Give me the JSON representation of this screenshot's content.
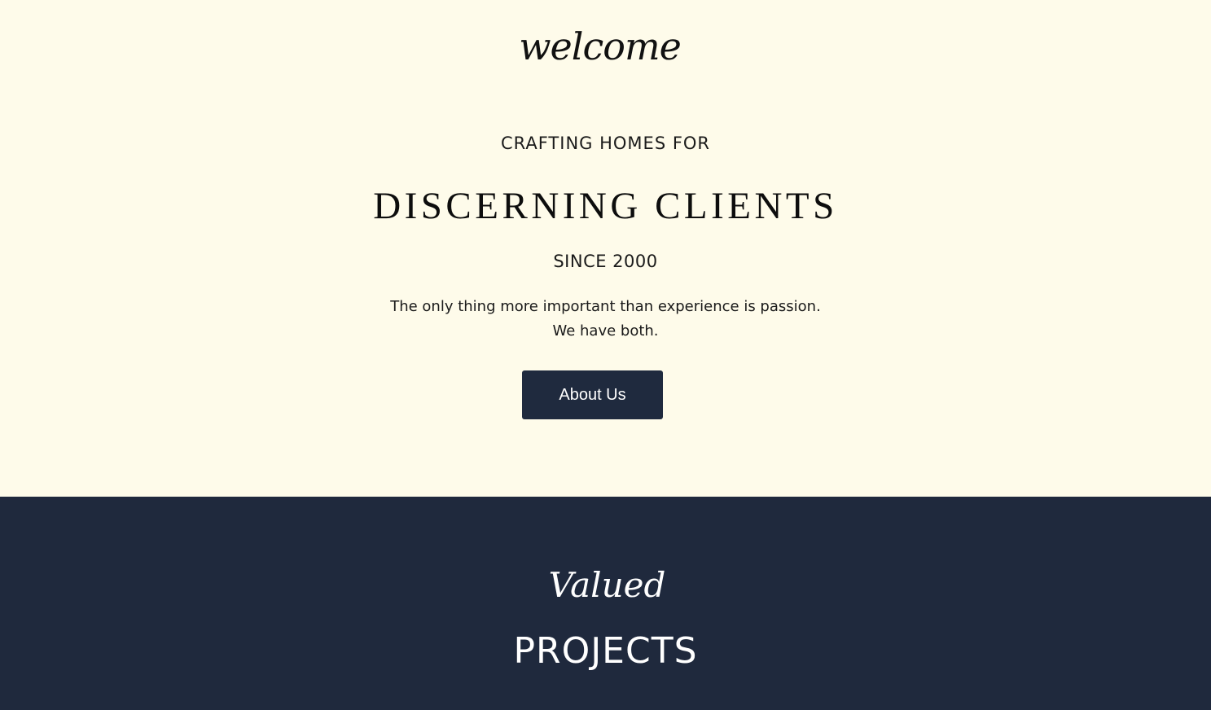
{
  "hero": {
    "script_heading": "welcome",
    "eyebrow": "CRAFTING HOMES FOR",
    "title": "DISCERNING CLIENTS",
    "subtitle": "SINCE 2000",
    "tagline_line1": "The only thing more important than experience is passion.",
    "tagline_line2": "We have both.",
    "cta_label": "About Us"
  },
  "projects": {
    "script_heading": "Valued",
    "title": "PROJECTS"
  },
  "colors": {
    "hero_background": "#fefbea",
    "dark_navy": "#1f293d",
    "button_background": "#1f2a3e",
    "text_dark": "#111111",
    "text_light": "#ffffff"
  }
}
